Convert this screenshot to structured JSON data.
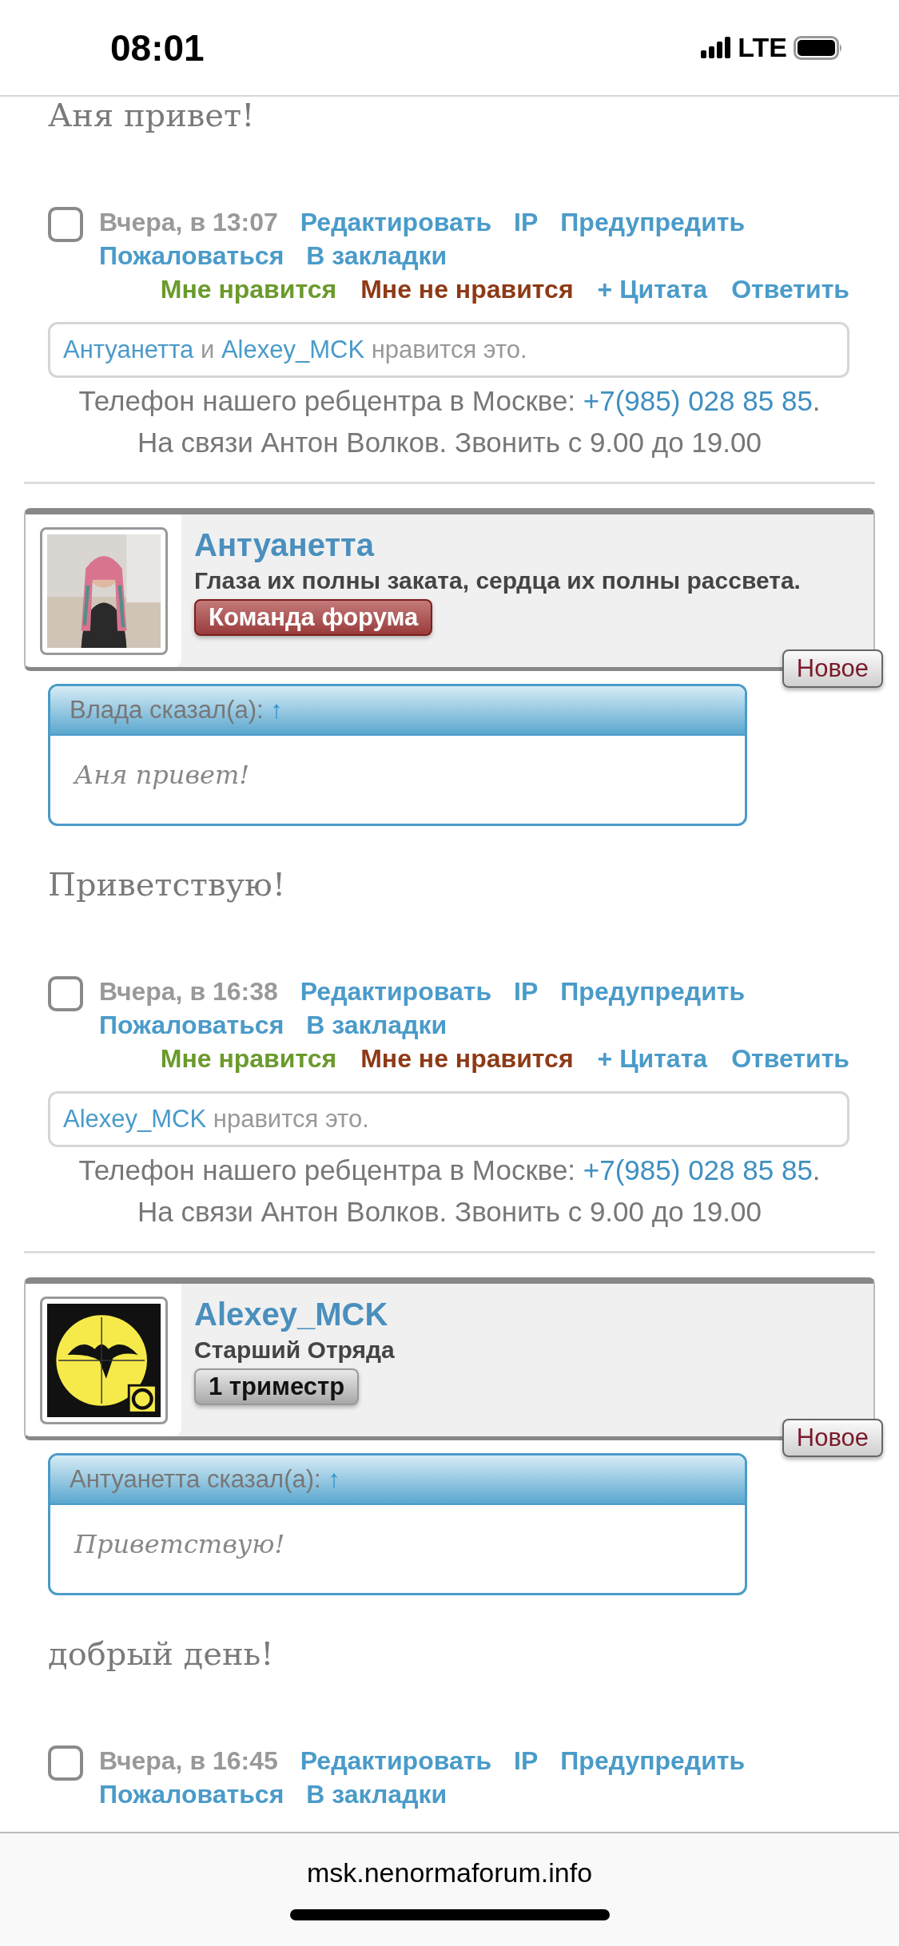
{
  "status_bar": {
    "time": "08:01",
    "network": "LTE"
  },
  "posts": [
    {
      "message": "Аня привет!",
      "footer": {
        "checked": false,
        "date": "Вчера, в 13:07",
        "links": [
          "Редактировать",
          "IP",
          "Предупредить",
          "Пожаловаться",
          "В закладки"
        ],
        "actions": [
          {
            "label": "Мне нравится",
            "kind": "like"
          },
          {
            "label": "Мне не нравится",
            "kind": "dislike"
          },
          {
            "label": "+ Цитата",
            "kind": "quote"
          },
          {
            "label": "Ответить",
            "kind": "reply"
          }
        ],
        "likes": {
          "users": [
            "Антуанетта",
            "Alexey_MCK"
          ],
          "joiner": "и",
          "suffix": "нравится это."
        },
        "signature": {
          "text": "Телефон нашего ребцентра в Москве:",
          "phone": "+7(985) 028 85 85",
          "end": ".",
          "line2": "На связи Антон Волков. Звонить с 9.00 до 19.00"
        }
      }
    },
    {
      "author": {
        "name": "Антуанетта",
        "status": "Глаза их полны заката, сердца их полны рассвета.",
        "badge": {
          "label": "Команда форума",
          "kind": "team"
        },
        "new_label": "Новое"
      },
      "quote": {
        "header": "Влада сказал(а):",
        "arrow": "↑",
        "text": "Аня привет!"
      },
      "message": "Приветствую!",
      "footer": {
        "checked": false,
        "date": "Вчера, в 16:38",
        "links": [
          "Редактировать",
          "IP",
          "Предупредить",
          "Пожаловаться",
          "В закладки"
        ],
        "actions": [
          {
            "label": "Мне нравится",
            "kind": "like"
          },
          {
            "label": "Мне не нравится",
            "kind": "dislike"
          },
          {
            "label": "+ Цитата",
            "kind": "quote"
          },
          {
            "label": "Ответить",
            "kind": "reply"
          }
        ],
        "likes": {
          "users": [
            "Alexey_MCK"
          ],
          "suffix": "нравится это."
        },
        "signature": {
          "text": "Телефон нашего ребцентра в Москве:",
          "phone": "+7(985) 028 85 85",
          "end": ".",
          "line2": "На связи Антон Волков. Звонить с 9.00 до 19.00"
        }
      }
    },
    {
      "author": {
        "name": "Alexey_MCK",
        "status": "Старший Отряда",
        "badge": {
          "label": "1 триместр",
          "kind": "rank"
        },
        "new_label": "Новое"
      },
      "quote": {
        "header": "Антуанетта сказал(а):",
        "arrow": "↑",
        "text": "Приветствую!"
      },
      "message": "добрый день!",
      "footer": {
        "checked": false,
        "date": "Вчера, в 16:45",
        "links": [
          "Редактировать",
          "IP",
          "Предупредить",
          "Пожаловаться",
          "В закладки"
        ]
      }
    }
  ],
  "address_bar": {
    "url": "msk.nenormaforum.info"
  }
}
